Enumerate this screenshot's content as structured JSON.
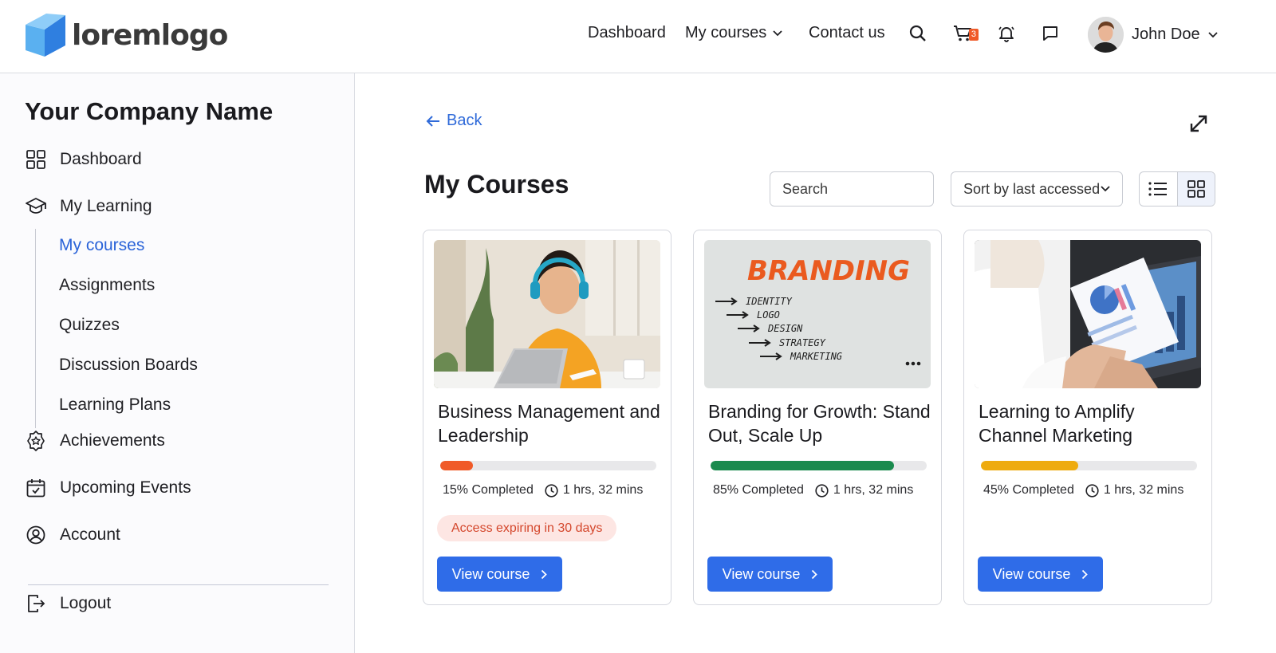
{
  "brand": {
    "logo_text": "loremlogo",
    "accent": "#2f6ce8"
  },
  "topnav": {
    "dashboard": "Dashboard",
    "my_courses": "My courses",
    "contact": "Contact us",
    "cart_count": "3",
    "user_name": "John Doe"
  },
  "sidebar": {
    "company": "Your Company Name",
    "dashboard": "Dashboard",
    "my_learning": "My Learning",
    "sub_items": [
      "My courses",
      "Assignments",
      "Quizzes",
      "Discussion Boards",
      "Learning Plans"
    ],
    "achievements": "Achievements",
    "upcoming_events": "Upcoming Events",
    "account": "Account",
    "logout": "Logout"
  },
  "main": {
    "back": "Back",
    "title": "My Courses",
    "search_placeholder": "Search",
    "sort_label": "Sort by last accessed"
  },
  "courses": [
    {
      "title": "Business Management and Leadership",
      "progress": 15,
      "progress_label": "15% Completed",
      "progress_color": "#f05a28",
      "duration": "1 hrs, 32 mins",
      "expiry": "Access expiring in 30 days",
      "button": "View course"
    },
    {
      "title": "Branding for Growth: Stand Out, Scale Up",
      "progress": 85,
      "progress_label": "85% Completed",
      "progress_color": "#1a8a4e",
      "duration": "1 hrs, 32 mins",
      "expiry": "",
      "button": "View course",
      "image_text": {
        "heading": "BRANDING",
        "lines": [
          "IDENTITY",
          "LOGO",
          "DESIGN",
          "STRATEGY",
          "MARKETING"
        ]
      }
    },
    {
      "title": "Learning to Amplify Channel Marketing",
      "progress": 45,
      "progress_label": "45% Completed",
      "progress_color": "#eeab0f",
      "duration": "1 hrs, 32 mins",
      "expiry": "",
      "button": "View course"
    }
  ]
}
